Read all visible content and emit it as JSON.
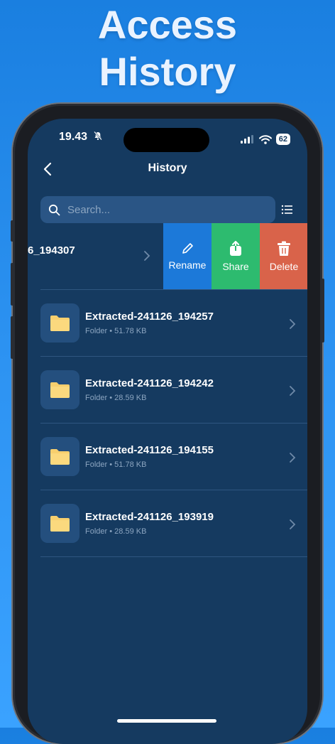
{
  "promo": {
    "line1": "Access",
    "line2": "History"
  },
  "status_bar": {
    "time": "19.43",
    "battery": "62"
  },
  "nav": {
    "title": "History"
  },
  "search": {
    "placeholder": "Search..."
  },
  "swiped_item": {
    "visible_name": "6_194307",
    "actions": [
      {
        "label": "Rename",
        "color": "#1c79d9",
        "icon": "pencil-icon"
      },
      {
        "label": "Share",
        "color": "#2dbb6f",
        "icon": "share-icon"
      },
      {
        "label": "Delete",
        "color": "#d9634a",
        "icon": "trash-icon"
      }
    ]
  },
  "items": [
    {
      "name": "Extracted-241126_194257",
      "type": "Folder",
      "size": "51.78 KB"
    },
    {
      "name": "Extracted-241126_194242",
      "type": "Folder",
      "size": "28.59 KB"
    },
    {
      "name": "Extracted-241126_194155",
      "type": "Folder",
      "size": "51.78 KB"
    },
    {
      "name": "Extracted-241126_193919",
      "type": "Folder",
      "size": "28.59 KB"
    }
  ],
  "colors": {
    "screen_bg": "#153a60",
    "folder": "#f7cf6e",
    "accent": "#1c79d9"
  }
}
